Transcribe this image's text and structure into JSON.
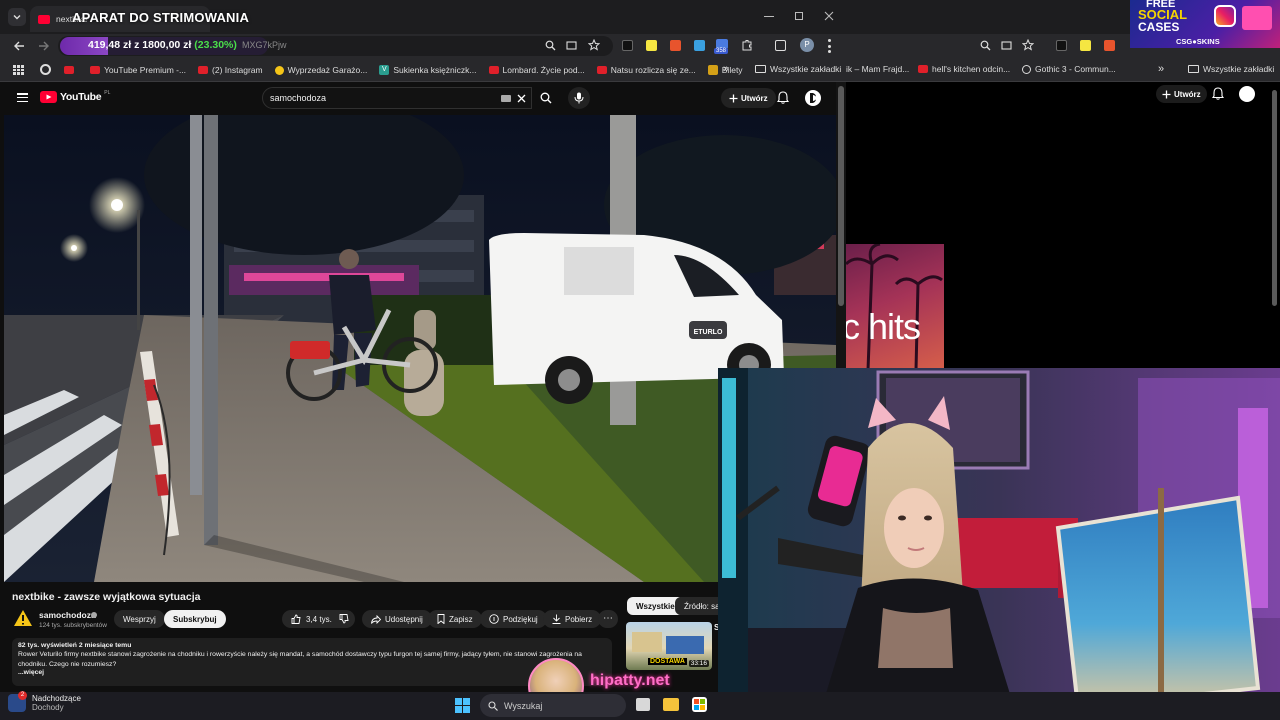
{
  "stream": {
    "overlay_title": "APARAT DO STRIMOWANIA",
    "balance_text": "419,48 zł",
    "goal_text": "z 1800,00 zł",
    "goal_percent_text": "(23.30%)",
    "goal_progress": 0.233,
    "watermark": "hipatty.net"
  },
  "browser_left": {
    "tab_title": "nextbike",
    "address_tail": "MXG7kPjw",
    "bookmarks": [
      {
        "label": "",
        "icon": "youtube-icon"
      },
      {
        "label": "YouTube Premium -...",
        "icon": "youtube-icon"
      },
      {
        "label": "(2) Instagram",
        "icon": "youtube-icon"
      },
      {
        "label": "Wyprzedaż Garażo...",
        "icon": "yellow-dot-icon"
      },
      {
        "label": "Sukienka księżniczk...",
        "icon": "v-icon"
      },
      {
        "label": "Lombard. Życie pod...",
        "icon": "youtube-icon"
      },
      {
        "label": "Natsu rozlicza się ze...",
        "icon": "youtube-icon"
      },
      {
        "label": "Bilety",
        "icon": "bilety-icon"
      }
    ],
    "more_bookmarks": "»",
    "all_bookmarks": "Wszystkie zakładki",
    "extension_badge": "358"
  },
  "youtube": {
    "logo": "YouTube",
    "logo_region": "PL",
    "search_value": "samochodoza",
    "create_label": "Utwórz",
    "video": {
      "title": "nextbike - zawsze wyjątkowa sytuacja",
      "van_text": "ETURLO",
      "channel": "samochodoza",
      "subscribers": "124 tys. subskrybentów",
      "support_label": "Wesprzyj",
      "subscribe_label": "Subskrybuj",
      "likes": "3,4 tys.",
      "share_label": "Udostępnij",
      "save_label": "Zapisz",
      "thanks_label": "Podziękuj",
      "download_label": "Pobierz",
      "views_date": "82 tys. wyświetleń  2 miesiące temu",
      "description": "Rower Veturilo firmy nextbike stanowi zagrożenie na chodniku i rowerzyście należy się mandat, a samochód dostawczy typu furgon tej samej firmy, jadący tyłem, nie stanowi zagrożenia na chodniku. Czego nie rozumiesz?",
      "more_label": "...więcej"
    },
    "filters": [
      "Wszystkie",
      "Źródło: sam"
    ],
    "recommended": {
      "duration": "33:16",
      "thumb_text": "DOSTAWA",
      "side_letter": "S"
    }
  },
  "browser_right": {
    "bookmarks": [
      "ik – Mam Frajd...",
      "hell's kitchen odcin...",
      "Gothic 3 - Commun..."
    ],
    "more_bookmarks": "»",
    "all_bookmarks": "Wszystkie zakładki",
    "create_label": "Utwórz",
    "thumb_text": "c hits"
  },
  "ad": {
    "line1": "FREE",
    "line2": "SOCIAL",
    "line3": "CASES",
    "brand": "CSG●SKINS"
  },
  "taskbar": {
    "news_title": "Nadchodzące",
    "news_sub": "Dochody",
    "search_placeholder": "Wyszukaj",
    "notification_count": "2"
  },
  "colors": {
    "accent_red": "#ff0033",
    "goal_green": "#4ade4a",
    "goal_bar": "#8a2be2"
  }
}
